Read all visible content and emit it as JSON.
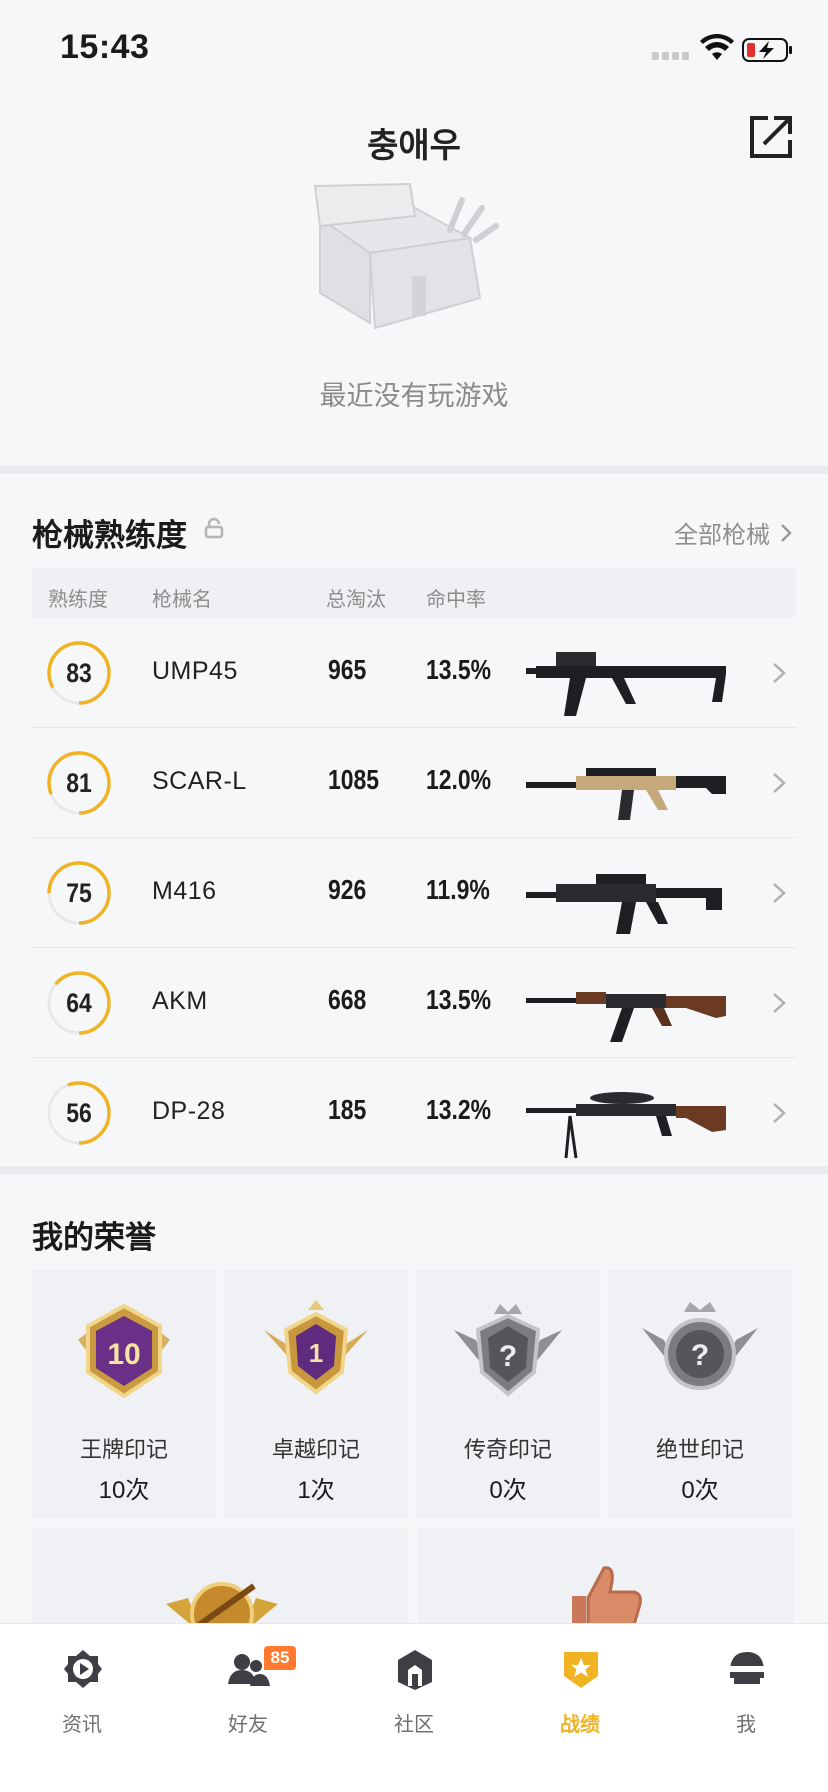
{
  "status_bar": {
    "time": "15:43"
  },
  "header": {
    "title": "충애우"
  },
  "recent": {
    "empty_text": "最近没有玩游戏"
  },
  "weapons": {
    "title": "枪械熟练度",
    "all_link": "全部枪械",
    "columns": {
      "proficiency": "熟练度",
      "name": "枪械名",
      "eliminations": "总淘汰",
      "accuracy": "命中率"
    },
    "rows": [
      {
        "proficiency": "83",
        "level": 0.83,
        "name": "UMP45",
        "eliminations": "965",
        "accuracy": "13.5%"
      },
      {
        "proficiency": "81",
        "level": 0.81,
        "name": "SCAR-L",
        "eliminations": "1085",
        "accuracy": "12.0%"
      },
      {
        "proficiency": "75",
        "level": 0.75,
        "name": "M416",
        "eliminations": "926",
        "accuracy": "11.9%"
      },
      {
        "proficiency": "64",
        "level": 0.64,
        "name": "AKM",
        "eliminations": "668",
        "accuracy": "13.5%"
      },
      {
        "proficiency": "56",
        "level": 0.56,
        "name": "DP-28",
        "eliminations": "185",
        "accuracy": "13.2%"
      }
    ]
  },
  "honors": {
    "title": "我的荣誉",
    "items": [
      {
        "name": "王牌印记",
        "count": "10次",
        "badge_text": "10"
      },
      {
        "name": "卓越印记",
        "count": "1次",
        "badge_text": "1"
      },
      {
        "name": "传奇印记",
        "count": "0次",
        "badge_text": "?"
      },
      {
        "name": "绝世印记",
        "count": "0次",
        "badge_text": "?"
      }
    ]
  },
  "tabs": [
    {
      "label": "资讯",
      "icon": "news-play-icon"
    },
    {
      "label": "好友",
      "icon": "friends-icon",
      "badge": "85"
    },
    {
      "label": "社区",
      "icon": "community-icon"
    },
    {
      "label": "战绩",
      "icon": "record-shield-icon",
      "active": true
    },
    {
      "label": "我",
      "icon": "helmet-icon"
    }
  ],
  "colors": {
    "accent": "#f0b323",
    "ring_track": "#e8e8ea",
    "badge": "#ff7a2f"
  }
}
